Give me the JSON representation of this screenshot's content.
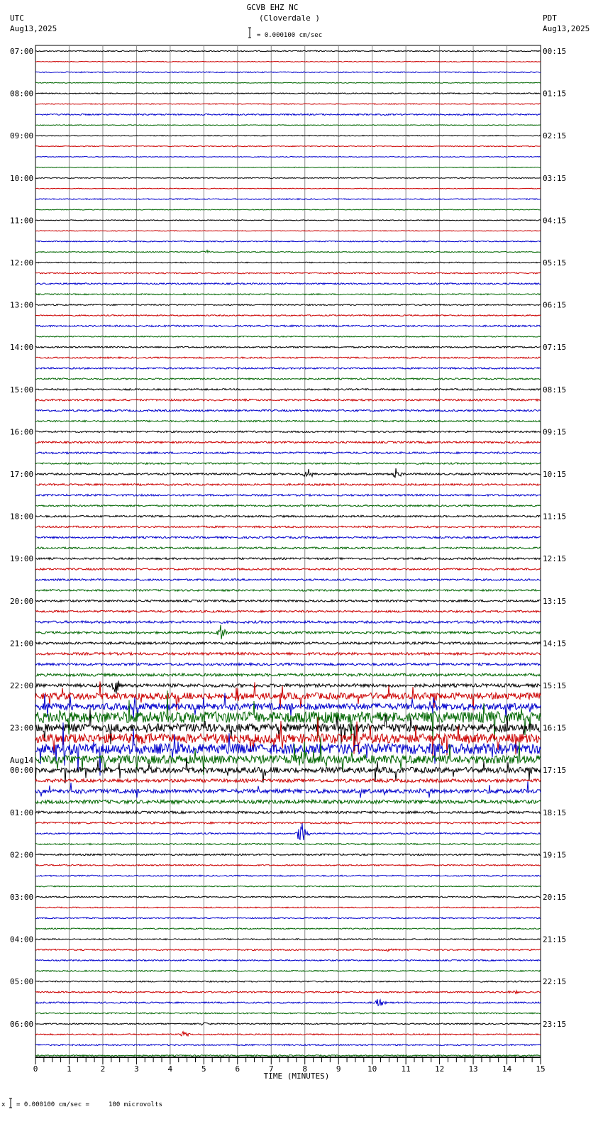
{
  "chart_data": {
    "type": "line",
    "title": "GCVB EHZ NC",
    "subtitle": "(Cloverdale )",
    "left_timezone": "UTC",
    "left_date": "Aug13,2025",
    "right_timezone": "PDT",
    "right_date": "Aug13,2025",
    "scale_label": "= 0.000100 cm/sec",
    "footer_scale": "= 0.000100 cm/sec =     100 microvolts",
    "footer_mark": "x",
    "xlabel": "TIME (MINUTES)",
    "xlim": [
      0,
      15
    ],
    "x_ticks": [
      "0",
      "1",
      "2",
      "3",
      "4",
      "5",
      "6",
      "7",
      "8",
      "9",
      "10",
      "11",
      "12",
      "13",
      "14",
      "15"
    ],
    "left_labels": [
      "07:00",
      "08:00",
      "09:00",
      "10:00",
      "11:00",
      "12:00",
      "13:00",
      "14:00",
      "15:00",
      "16:00",
      "17:00",
      "18:00",
      "19:00",
      "20:00",
      "21:00",
      "22:00",
      "23:00",
      "00:00",
      "01:00",
      "02:00",
      "03:00",
      "04:00",
      "05:00",
      "06:00"
    ],
    "left_date_change": {
      "hour_index": 17,
      "label": "Aug14"
    },
    "right_labels": [
      "00:15",
      "01:15",
      "02:15",
      "03:15",
      "04:15",
      "05:15",
      "06:15",
      "07:15",
      "08:15",
      "09:15",
      "10:15",
      "11:15",
      "12:15",
      "13:15",
      "14:15",
      "15:15",
      "16:15",
      "17:15",
      "18:15",
      "19:15",
      "20:15",
      "21:15",
      "22:15",
      "23:15"
    ],
    "trace_colors": [
      "#000000",
      "#cc0000",
      "#0000cc",
      "#006600"
    ],
    "traces_per_hour": 4,
    "noise_levels": [
      0.6,
      0.4,
      0.6,
      0.4,
      0.6,
      0.5,
      0.8,
      0.4,
      0.5,
      0.5,
      0.4,
      0.4,
      0.5,
      0.4,
      0.6,
      0.4,
      0.5,
      0.4,
      0.6,
      0.5,
      0.6,
      0.7,
      0.8,
      0.7,
      0.7,
      0.7,
      0.9,
      0.6,
      0.8,
      0.8,
      0.9,
      0.8,
      0.9,
      1.0,
      1.0,
      0.9,
      0.9,
      1.0,
      1.0,
      0.9,
      1.0,
      1.0,
      1.0,
      0.9,
      1.0,
      1.0,
      1.0,
      1.0,
      1.0,
      1.0,
      1.0,
      1.0,
      1.1,
      1.1,
      1.3,
      1.2,
      1.3,
      1.4,
      1.3,
      1.5,
      1.8,
      3.5,
      3.5,
      6.0,
      4.5,
      5.0,
      5.5,
      4.5,
      3.0,
      1.8,
      2.2,
      2.0,
      1.3,
      1.0,
      0.8,
      0.8,
      0.9,
      0.7,
      0.7,
      0.6,
      0.7,
      0.6,
      0.7,
      0.6,
      0.7,
      0.8,
      0.7,
      0.7,
      0.7,
      0.8,
      0.8,
      0.7,
      0.7,
      0.7,
      0.8,
      0.7
    ],
    "events": [
      {
        "trace": 19,
        "minute": 5.1,
        "amplitude": 3
      },
      {
        "trace": 40,
        "minute": 8.1,
        "amplitude": 9
      },
      {
        "trace": 40,
        "minute": 10.7,
        "amplitude": 9
      },
      {
        "trace": 55,
        "minute": 5.5,
        "amplitude": 12
      },
      {
        "trace": 60,
        "minute": 2.4,
        "amplitude": 14
      },
      {
        "trace": 61,
        "minute": 6.0,
        "amplitude": 12
      },
      {
        "trace": 62,
        "minute": 11.8,
        "amplitude": 14
      },
      {
        "trace": 67,
        "minute": 7.9,
        "amplitude": 18
      },
      {
        "trace": 74,
        "minute": 7.9,
        "amplitude": 20
      },
      {
        "trace": 85,
        "minute": 10.5,
        "amplitude": 3
      },
      {
        "trace": 89,
        "minute": 14.2,
        "amplitude": 3
      },
      {
        "trace": 90,
        "minute": 10.2,
        "amplitude": 7
      },
      {
        "trace": 92,
        "minute": 5.0,
        "amplitude": 3
      },
      {
        "trace": 93,
        "minute": 4.4,
        "amplitude": 5
      }
    ]
  }
}
